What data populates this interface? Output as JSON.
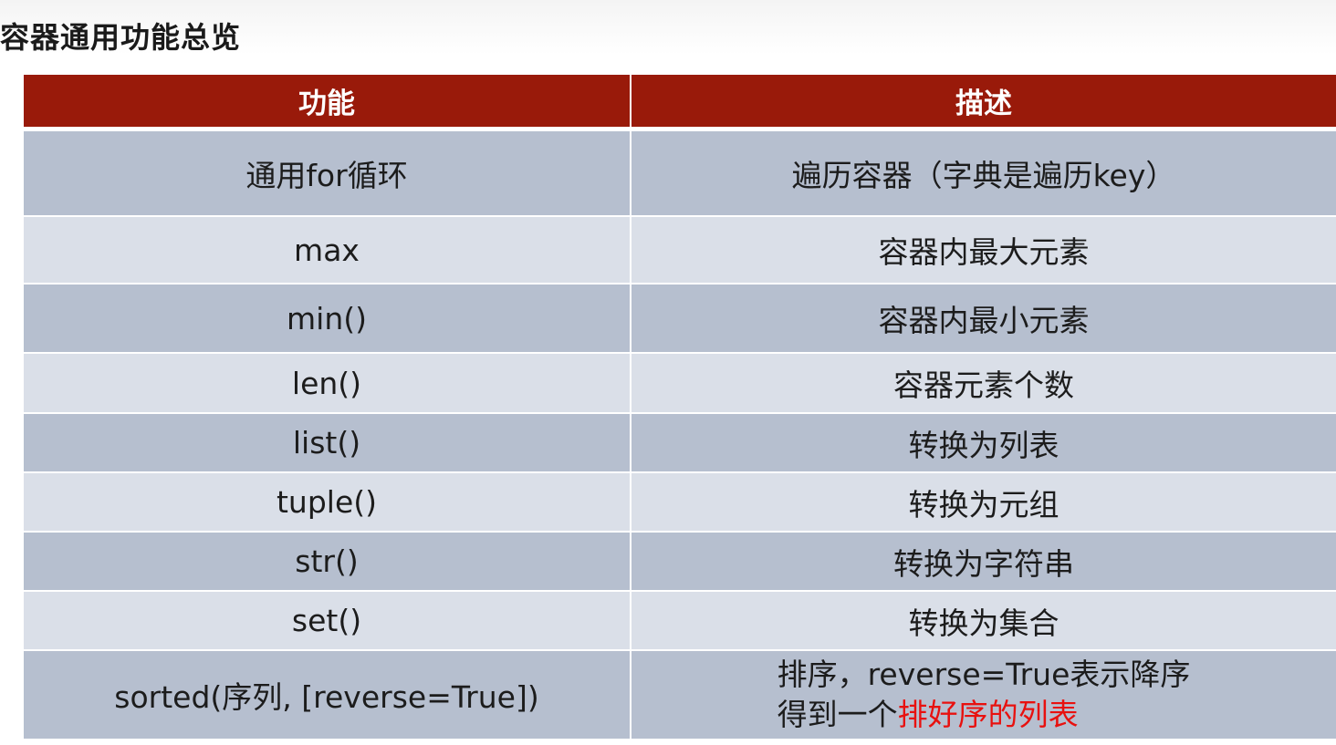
{
  "page": {
    "title": "容器通用功能总览"
  },
  "table": {
    "headers": [
      "功能",
      "描述"
    ],
    "rows": [
      {
        "function": "通用for循环",
        "description": "遍历容器（字典是遍历key）"
      },
      {
        "function": "max",
        "description": "容器内最大元素"
      },
      {
        "function": "min()",
        "description": "容器内最小元素"
      },
      {
        "function": "len()",
        "description": "容器元素个数"
      },
      {
        "function": "list()",
        "description": "转换为列表"
      },
      {
        "function": "tuple()",
        "description": "转换为元组"
      },
      {
        "function": "str()",
        "description": "转换为字符串"
      },
      {
        "function": "set()",
        "description": "转换为集合"
      },
      {
        "function": "sorted(序列, [reverse=True])",
        "description_line1": "排序，reverse=True表示降序",
        "description_line2_prefix": "得到一个",
        "description_line2_highlight": "排好序的列表"
      }
    ]
  },
  "colors": {
    "header_bg": "#991a0a",
    "row_dark": "#b6bfcf",
    "row_light": "#dadfe8",
    "highlight": "#e8110f"
  }
}
